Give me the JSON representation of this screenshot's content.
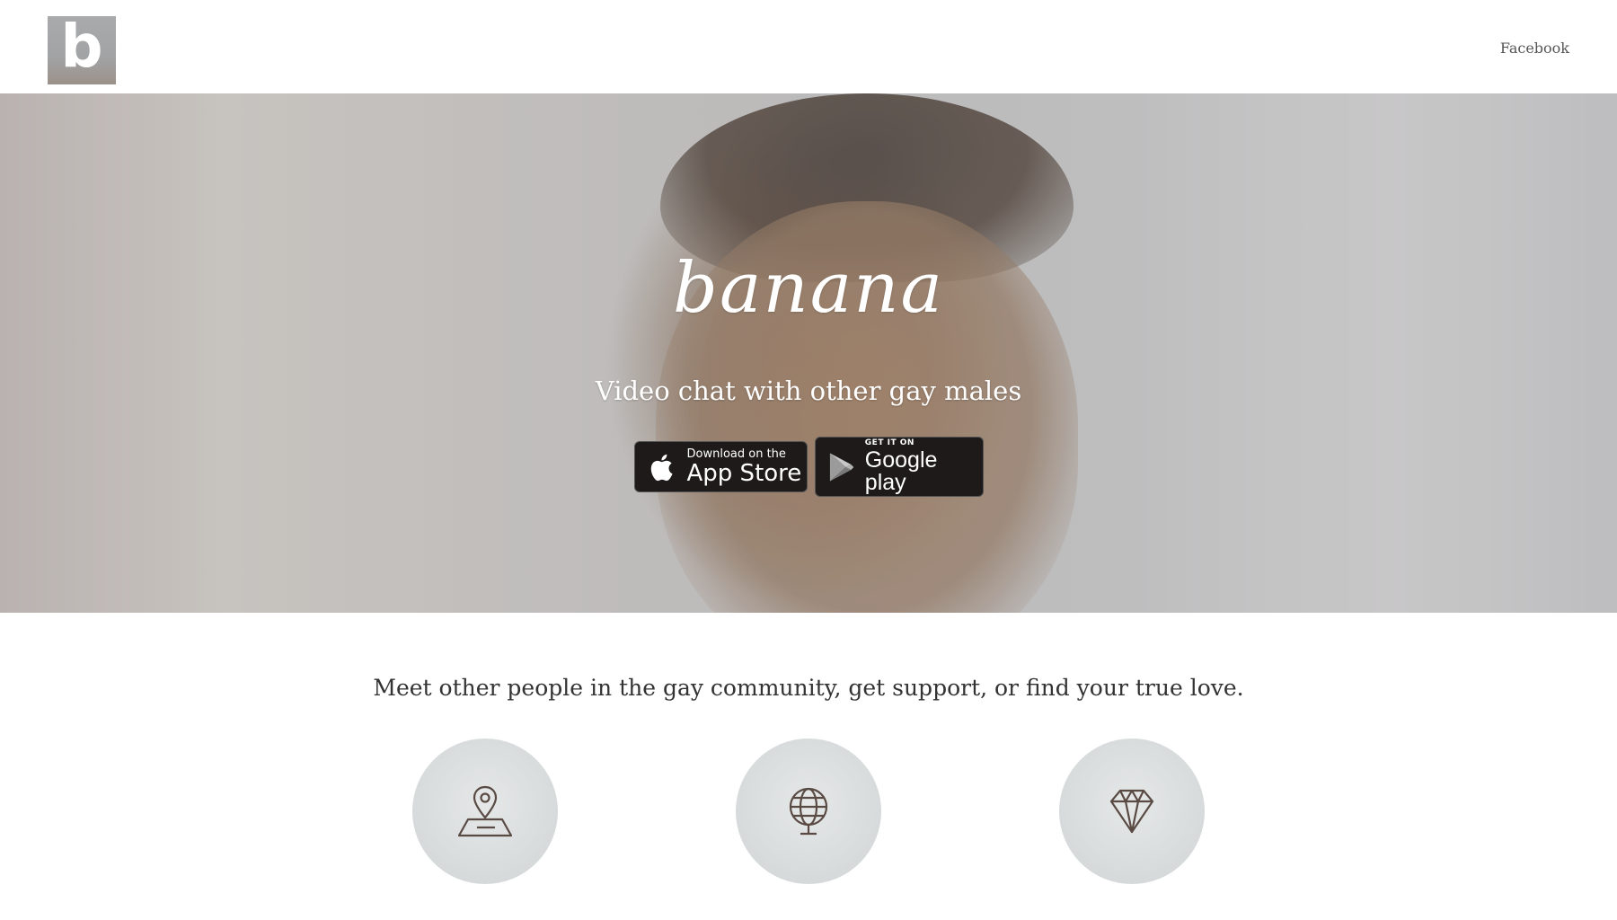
{
  "header": {
    "logo_letter": "b",
    "nav_facebook": "Facebook"
  },
  "hero": {
    "brand_name": "banana",
    "tagline": "Video chat with other gay males",
    "app_store": {
      "small": "Download on the",
      "big": "App Store"
    },
    "google_play": {
      "small": "GET IT ON",
      "big": "Google play"
    }
  },
  "intro": {
    "text": "Meet other people in the gay community, get support, or find your true love."
  },
  "features": [
    {
      "icon": "map-pin-icon"
    },
    {
      "icon": "globe-icon"
    },
    {
      "icon": "diamond-icon"
    }
  ],
  "colors": {
    "badge_bg": "#1d1a19",
    "icon_stroke": "#5a4a44",
    "text_dark": "#333333",
    "hero_text": "#ffffff"
  }
}
